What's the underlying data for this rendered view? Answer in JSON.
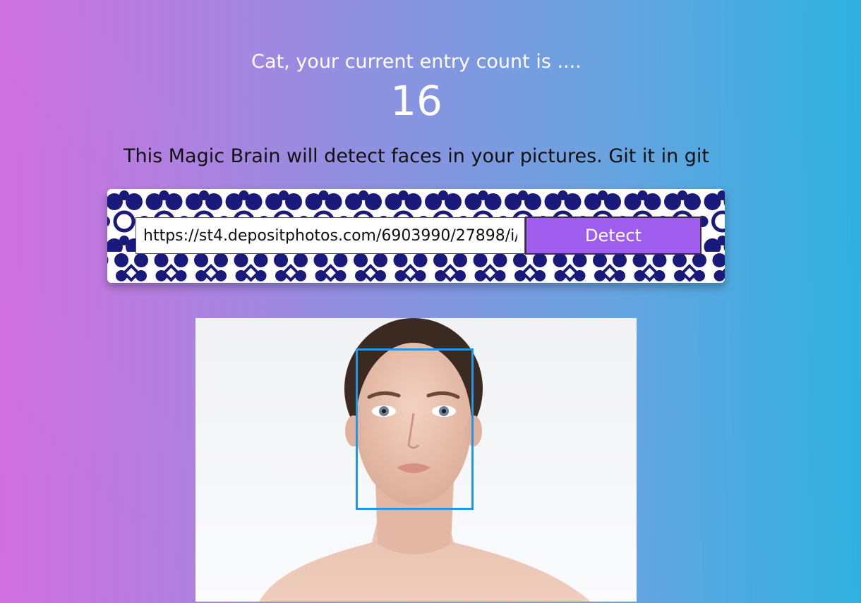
{
  "rank": {
    "user_name": "Cat",
    "message": "Cat, your current entry count is ....",
    "entry_count": "16"
  },
  "tagline": "This Magic Brain will detect faces in your pictures. Git it in git",
  "image_link_form": {
    "url_value": "https://st4.depositphotos.com/6903990/27898/i/",
    "detect_label": "Detect",
    "button_color": "#a05eef",
    "pattern_color": "#1a1a7a"
  },
  "face_recognition": {
    "image_description": "portrait photo",
    "box_color": "#1f96e8"
  }
}
